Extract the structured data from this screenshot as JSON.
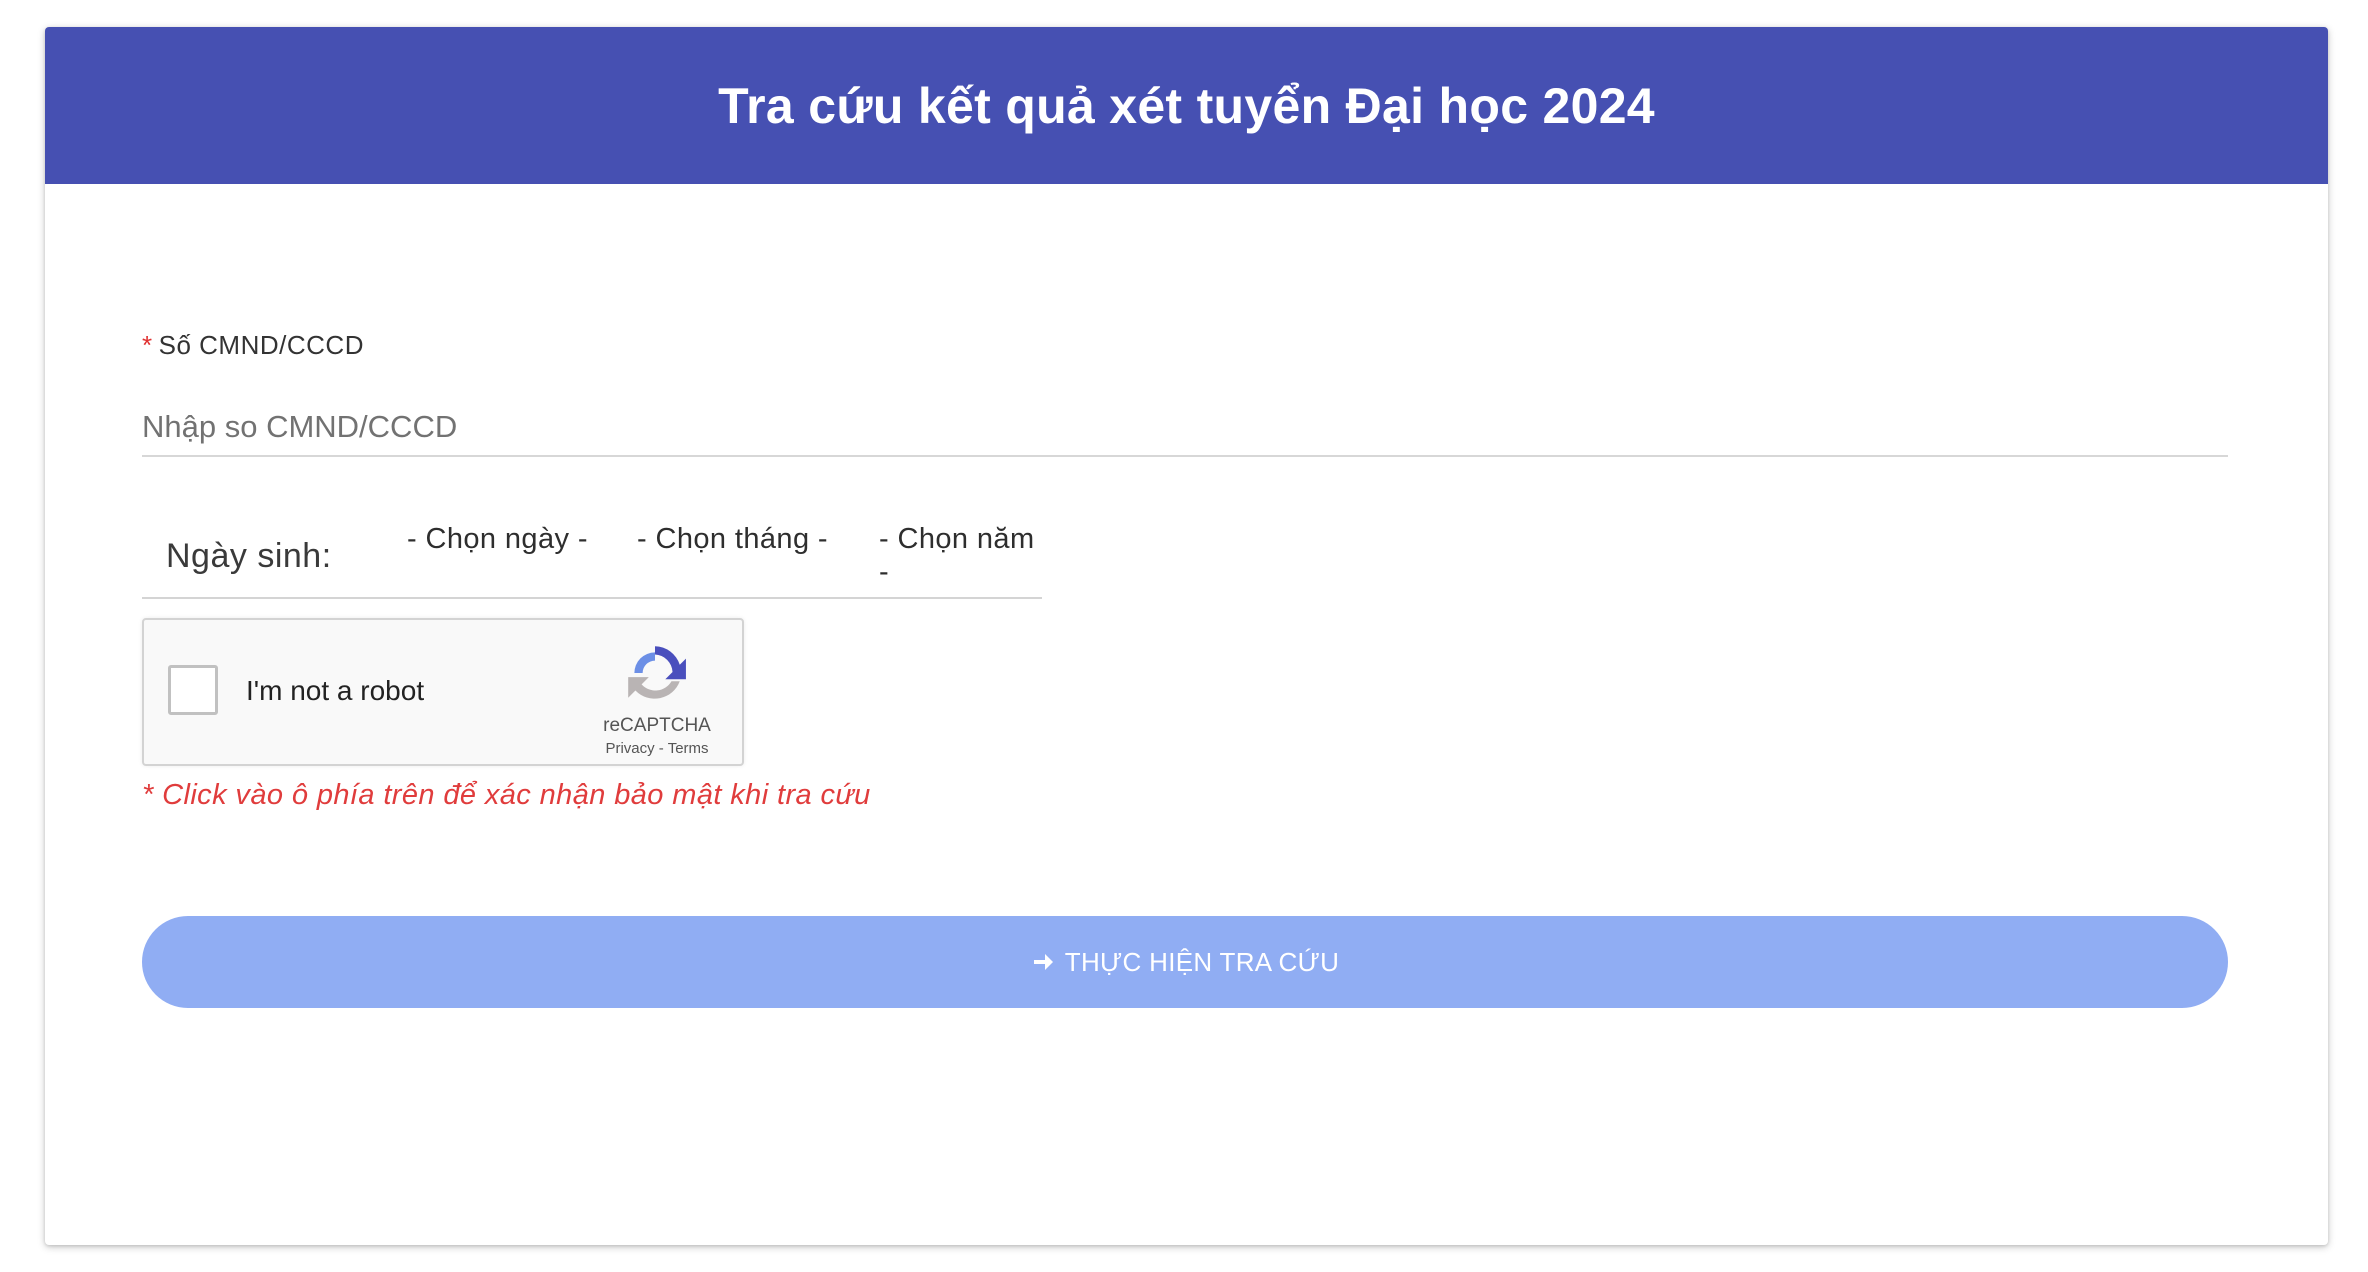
{
  "header": {
    "title": "Tra cứu kết quả xét tuyển Đại học 2024"
  },
  "form": {
    "id_field": {
      "required_mark": "*",
      "label": "Số CMND/CCCD",
      "placeholder": "Nhập so CMND/CCCD",
      "value": ""
    },
    "dob": {
      "label": "Ngày sinh:",
      "day_selected": "- Chọn ngày -",
      "month_selected": "- Chọn tháng -",
      "year_selected": "- Chọn năm -"
    },
    "recaptcha": {
      "checkbox_label": "I'm not a robot",
      "checked": false,
      "brand": "reCAPTCHA",
      "privacy": "Privacy",
      "separator": "-",
      "terms": "Terms",
      "icon": "recaptcha-logo-icon"
    },
    "captcha_note": "* Click vào ô phía trên để xác nhận bảo mật khi tra cứu",
    "submit": {
      "label": "THỰC HIỆN TRA CỨU",
      "icon": "arrow-right-icon"
    }
  },
  "colors": {
    "header_bg": "#4650b2",
    "button_bg": "#90adf3",
    "required": "#e03030",
    "note": "#e03c3c"
  }
}
